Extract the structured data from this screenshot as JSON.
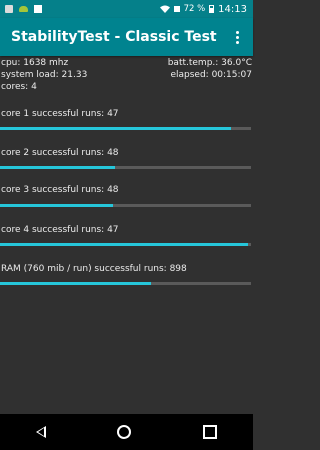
{
  "status_bar": {
    "battery": "72 %",
    "time": "14:13"
  },
  "app_bar": {
    "title": "StabilityTest - Classic Test"
  },
  "stats": {
    "cpu": "cpu: 1638 mhz",
    "batt_temp": "batt.temp.: 36.0°C",
    "system_load": "system load: 21.33",
    "elapsed": "elapsed: 00:15:07",
    "cores": "cores: 4"
  },
  "tests": [
    {
      "label": "core 1 successful runs: 47",
      "progress": 0.92
    },
    {
      "label": "core 2 successful runs: 48",
      "progress": 0.46
    },
    {
      "label": "core 3 successful runs: 48",
      "progress": 0.45
    },
    {
      "label": "core 4 successful runs: 47",
      "progress": 0.99
    },
    {
      "label": "RAM (760 mib / run) successful runs: 898",
      "progress": 0.6
    }
  ]
}
